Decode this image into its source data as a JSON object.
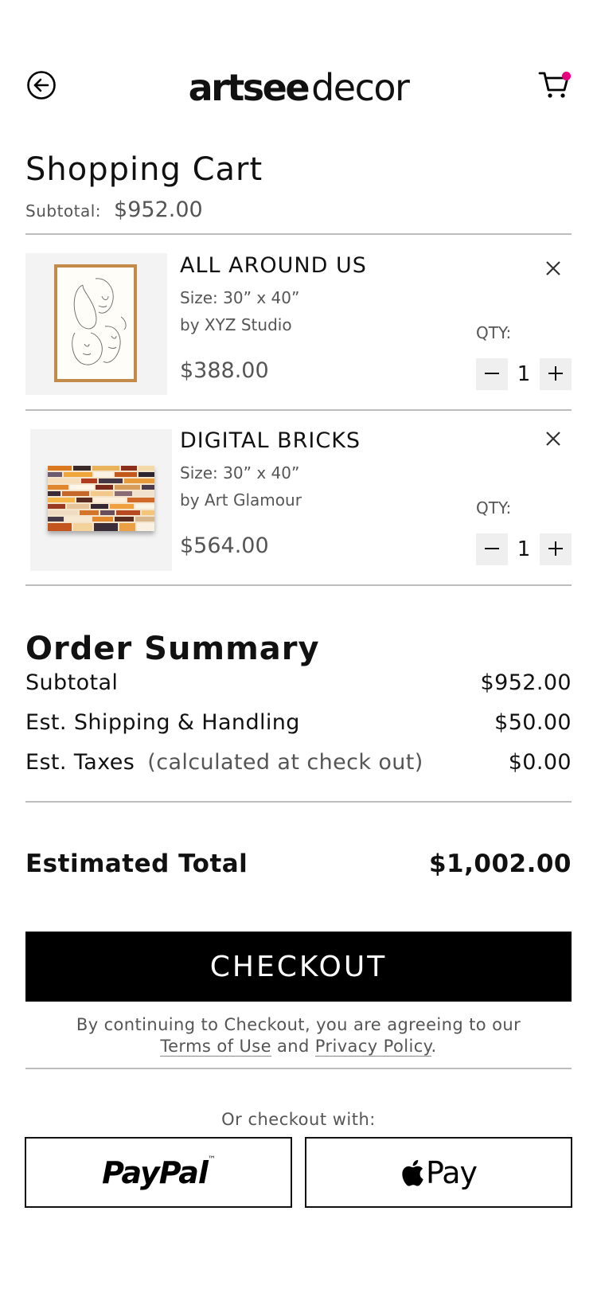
{
  "header": {
    "logo_bold": "artsee",
    "logo_light": "decor"
  },
  "page": {
    "title": "Shopping Cart",
    "subtotal_label": "Subtotal:",
    "subtotal_value": "$952.00"
  },
  "cart": {
    "qty_label": "QTY:",
    "items": [
      {
        "name": "ALL AROUND US",
        "size": "Size: 30” x 40”",
        "artist": "by XYZ Studio",
        "price": "$388.00",
        "qty": "1"
      },
      {
        "name": "DIGITAL BRICKS",
        "size": "Size: 30” x 40”",
        "artist": "by Art Glamour",
        "price": "$564.00",
        "qty": "1"
      }
    ]
  },
  "summary": {
    "title": "Order Summary",
    "rows": [
      {
        "label": "Subtotal",
        "note": "",
        "value": "$952.00"
      },
      {
        "label": "Est. Shipping & Handling",
        "note": "",
        "value": "$50.00"
      },
      {
        "label": "Est. Taxes",
        "note": "(calculated at check out)",
        "value": "$0.00"
      }
    ],
    "total_label": "Estimated Total",
    "total_value": "$1,002.00"
  },
  "checkout": {
    "button_label": "CHECKOUT",
    "legal_prefix": "By continuing to Checkout, you are agreeing to our",
    "terms_label": "Terms of Use",
    "legal_and": "and",
    "privacy_label": "Privacy Policy",
    "legal_suffix": ".",
    "alt_label": "Or checkout with:",
    "paypal_label": "PayPal",
    "paypal_tm": "™",
    "applepay_label": "Pay"
  },
  "colors": {
    "accent_dot": "#e6007e",
    "text_muted": "#555555",
    "button_bg": "#000000"
  },
  "icons": {
    "back": "arrow-left-circle-icon",
    "cart": "shopping-cart-icon",
    "remove": "close-icon",
    "minus": "minus-icon",
    "plus": "plus-icon",
    "apple": "apple-logo-icon"
  }
}
